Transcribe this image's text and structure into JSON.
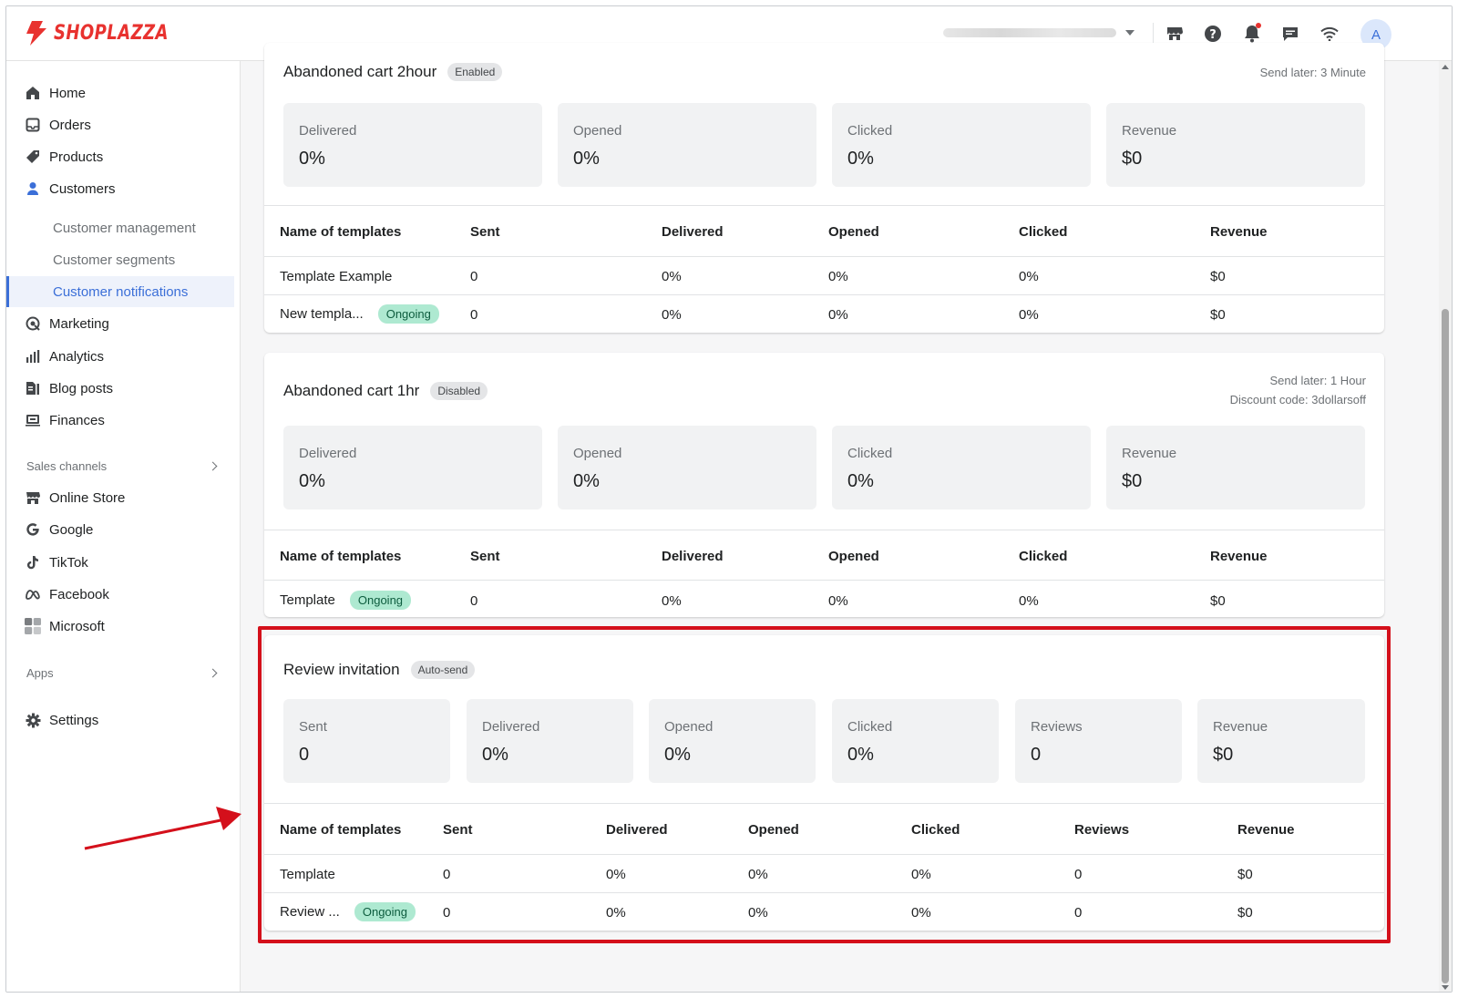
{
  "brand": {
    "name": "SHOPLAZZA",
    "color": "#e8322f"
  },
  "topbar": {
    "icons": [
      "store-icon",
      "help-icon",
      "bell-icon",
      "chat-icon",
      "wifi-icon"
    ],
    "avatar_initial": "A"
  },
  "sidebar": {
    "items": [
      {
        "label": "Home",
        "icon": "home-icon"
      },
      {
        "label": "Orders",
        "icon": "inbox-icon"
      },
      {
        "label": "Products",
        "icon": "tag-icon"
      },
      {
        "label": "Customers",
        "icon": "person-icon"
      }
    ],
    "customer_subitems": [
      {
        "label": "Customer management"
      },
      {
        "label": "Customer segments"
      },
      {
        "label": "Customer notifications",
        "active": true
      }
    ],
    "more_items": [
      {
        "label": "Marketing",
        "icon": "marketing-icon"
      },
      {
        "label": "Analytics",
        "icon": "analytics-icon"
      },
      {
        "label": "Blog posts",
        "icon": "blog-icon"
      },
      {
        "label": "Finances",
        "icon": "finance-icon"
      }
    ],
    "sales_channels_label": "Sales channels",
    "channels": [
      {
        "label": "Online Store",
        "icon": "store-icon"
      },
      {
        "label": "Google",
        "icon": "google-icon"
      },
      {
        "label": "TikTok",
        "icon": "tiktok-icon"
      },
      {
        "label": "Facebook",
        "icon": "meta-icon"
      },
      {
        "label": "Microsoft",
        "icon": "microsoft-icon"
      }
    ],
    "apps_label": "Apps",
    "settings_label": "Settings"
  },
  "cards": [
    {
      "title": "Abandoned cart 2hour",
      "badge": "Enabled",
      "meta": [
        "Send later: 3 Minute"
      ],
      "stats": [
        {
          "label": "Delivered",
          "value": "0%"
        },
        {
          "label": "Opened",
          "value": "0%"
        },
        {
          "label": "Clicked",
          "value": "0%"
        },
        {
          "label": "Revenue",
          "value": "$0"
        }
      ],
      "columns": [
        "Name of templates",
        "Sent",
        "Delivered",
        "Opened",
        "Clicked",
        "Revenue"
      ],
      "rows": [
        {
          "name": "Template Example",
          "status": "",
          "cells": [
            "0",
            "0%",
            "0%",
            "0%",
            "$0"
          ]
        },
        {
          "name": "New templa...",
          "status": "Ongoing",
          "cells": [
            "0",
            "0%",
            "0%",
            "0%",
            "$0"
          ]
        }
      ]
    },
    {
      "title": "Abandoned cart 1hr",
      "badge": "Disabled",
      "meta": [
        "Send later: 1 Hour",
        "Discount code: 3dollarsoff"
      ],
      "stats": [
        {
          "label": "Delivered",
          "value": "0%"
        },
        {
          "label": "Opened",
          "value": "0%"
        },
        {
          "label": "Clicked",
          "value": "0%"
        },
        {
          "label": "Revenue",
          "value": "$0"
        }
      ],
      "columns": [
        "Name of templates",
        "Sent",
        "Delivered",
        "Opened",
        "Clicked",
        "Revenue"
      ],
      "rows": [
        {
          "name": "Template",
          "status": "Ongoing",
          "cells": [
            "0",
            "0%",
            "0%",
            "0%",
            "$0"
          ]
        }
      ]
    },
    {
      "title": "Review invitation",
      "badge": "Auto-send",
      "meta": [],
      "stats": [
        {
          "label": "Sent",
          "value": "0"
        },
        {
          "label": "Delivered",
          "value": "0%"
        },
        {
          "label": "Opened",
          "value": "0%"
        },
        {
          "label": "Clicked",
          "value": "0%"
        },
        {
          "label": "Reviews",
          "value": "0"
        },
        {
          "label": "Revenue",
          "value": "$0"
        }
      ],
      "columns": [
        "Name of templates",
        "Sent",
        "Delivered",
        "Opened",
        "Clicked",
        "Reviews",
        "Revenue"
      ],
      "rows": [
        {
          "name": "Template",
          "status": "",
          "cells": [
            "0",
            "0%",
            "0%",
            "0%",
            "0",
            "$0"
          ]
        },
        {
          "name": "Review ...",
          "status": "Ongoing",
          "cells": [
            "0",
            "0%",
            "0%",
            "0%",
            "0",
            "$0"
          ]
        }
      ]
    }
  ],
  "annotation": {
    "highlight_color": "#d4101b"
  }
}
